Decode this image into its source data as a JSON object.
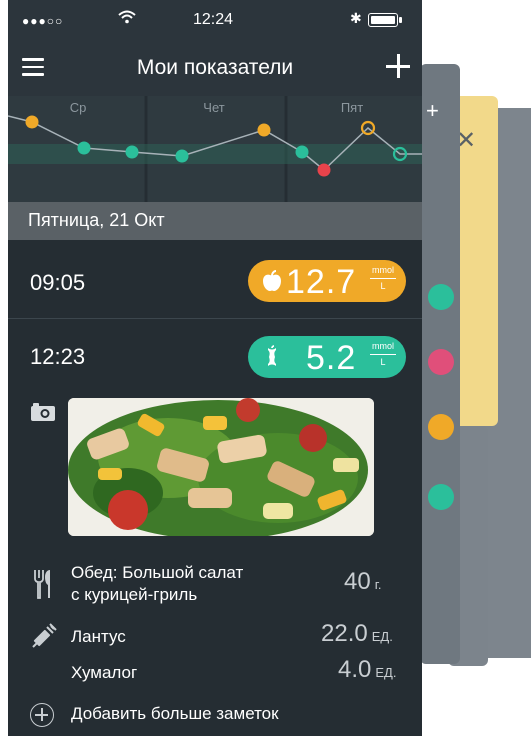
{
  "status_bar": {
    "time": "12:24"
  },
  "navbar": {
    "title": "Мои показатели"
  },
  "chart_data": {
    "type": "line",
    "categories": [
      "Ср",
      "Чет",
      "Пят"
    ],
    "points": [
      {
        "color": "orange"
      },
      {
        "color": "green"
      },
      {
        "color": "green"
      },
      {
        "color": "green"
      },
      {
        "color": "orange"
      },
      {
        "color": "green"
      },
      {
        "color": "red"
      },
      {
        "color": "orange-open"
      },
      {
        "color": "green-open"
      }
    ]
  },
  "date_band": "Пятница, 21 Окт",
  "entries": [
    {
      "time": "09:05",
      "value": "12.7",
      "unit_top": "mmol",
      "unit_bottom": "L",
      "color": "#f0a928"
    },
    {
      "time": "12:23",
      "value": "5.2",
      "unit_top": "mmol",
      "unit_bottom": "L",
      "color": "#2bbf9b"
    }
  ],
  "notes": {
    "meal": {
      "label": "Обед: Большой салат\nс курицей-гриль",
      "amount": "40",
      "unit": "г."
    },
    "insulin1": {
      "label": "Лантус",
      "amount": "22.0",
      "unit": "ЕД."
    },
    "insulin2": {
      "label": "Хумалог",
      "amount": "4.0",
      "unit": "ЕД."
    },
    "add": "Добавить больше заметок"
  },
  "colors": {
    "accent_orange": "#f0a928",
    "accent_green": "#2bbf9b",
    "accent_red": "#e8434b",
    "background": "#252d33"
  }
}
